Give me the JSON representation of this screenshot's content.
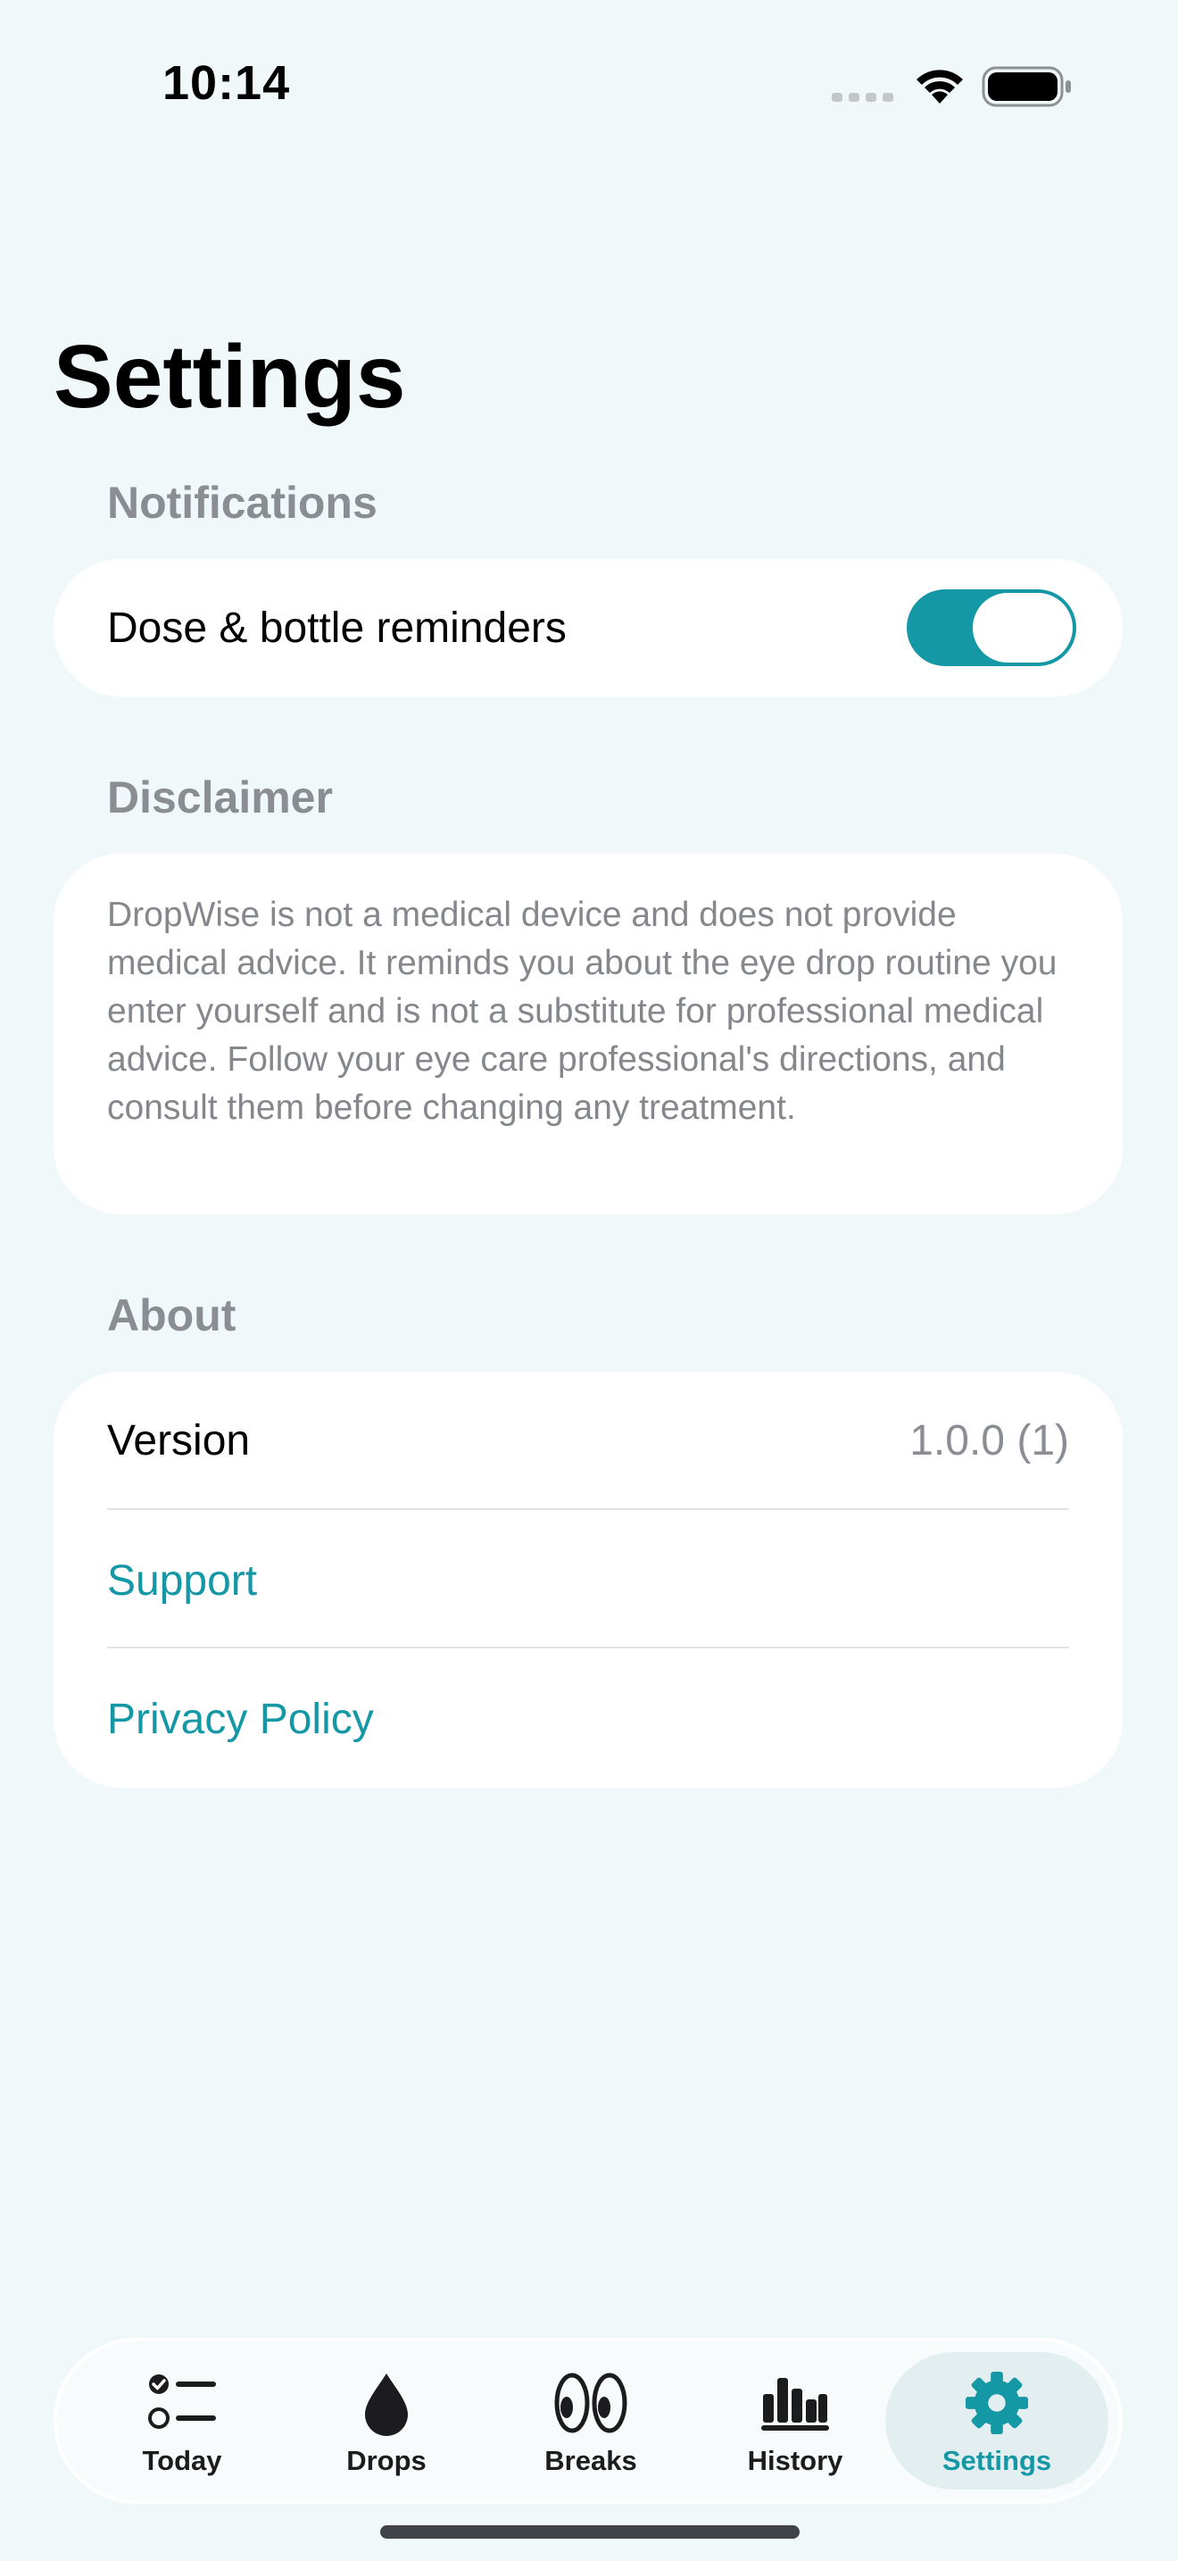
{
  "status_bar": {
    "time": "10:14"
  },
  "page": {
    "title": "Settings"
  },
  "notifications": {
    "header": "Notifications",
    "reminders_label": "Dose & bottle reminders",
    "reminders_enabled": true
  },
  "disclaimer": {
    "header": "Disclaimer",
    "text": "DropWise is not a medical device and does not provide medical advice. It reminds you about the eye drop routine you enter yourself and is not a substitute for professional medical advice. Follow your eye care professional's directions, and consult them before changing any treatment."
  },
  "about": {
    "header": "About",
    "version_label": "Version",
    "version_value": "1.0.0 (1)",
    "support_label": "Support",
    "privacy_label": "Privacy Policy"
  },
  "tab_bar": {
    "items": [
      {
        "label": "Today",
        "icon": "checklist-icon"
      },
      {
        "label": "Drops",
        "icon": "drop-icon"
      },
      {
        "label": "Breaks",
        "icon": "eyes-icon"
      },
      {
        "label": "History",
        "icon": "chart-bars-icon"
      },
      {
        "label": "Settings",
        "icon": "gear-icon"
      }
    ],
    "active": "Settings"
  },
  "colors": {
    "accent": "#1498a6",
    "background": "#f0f8fa",
    "secondary_text": "#8a8e93"
  }
}
